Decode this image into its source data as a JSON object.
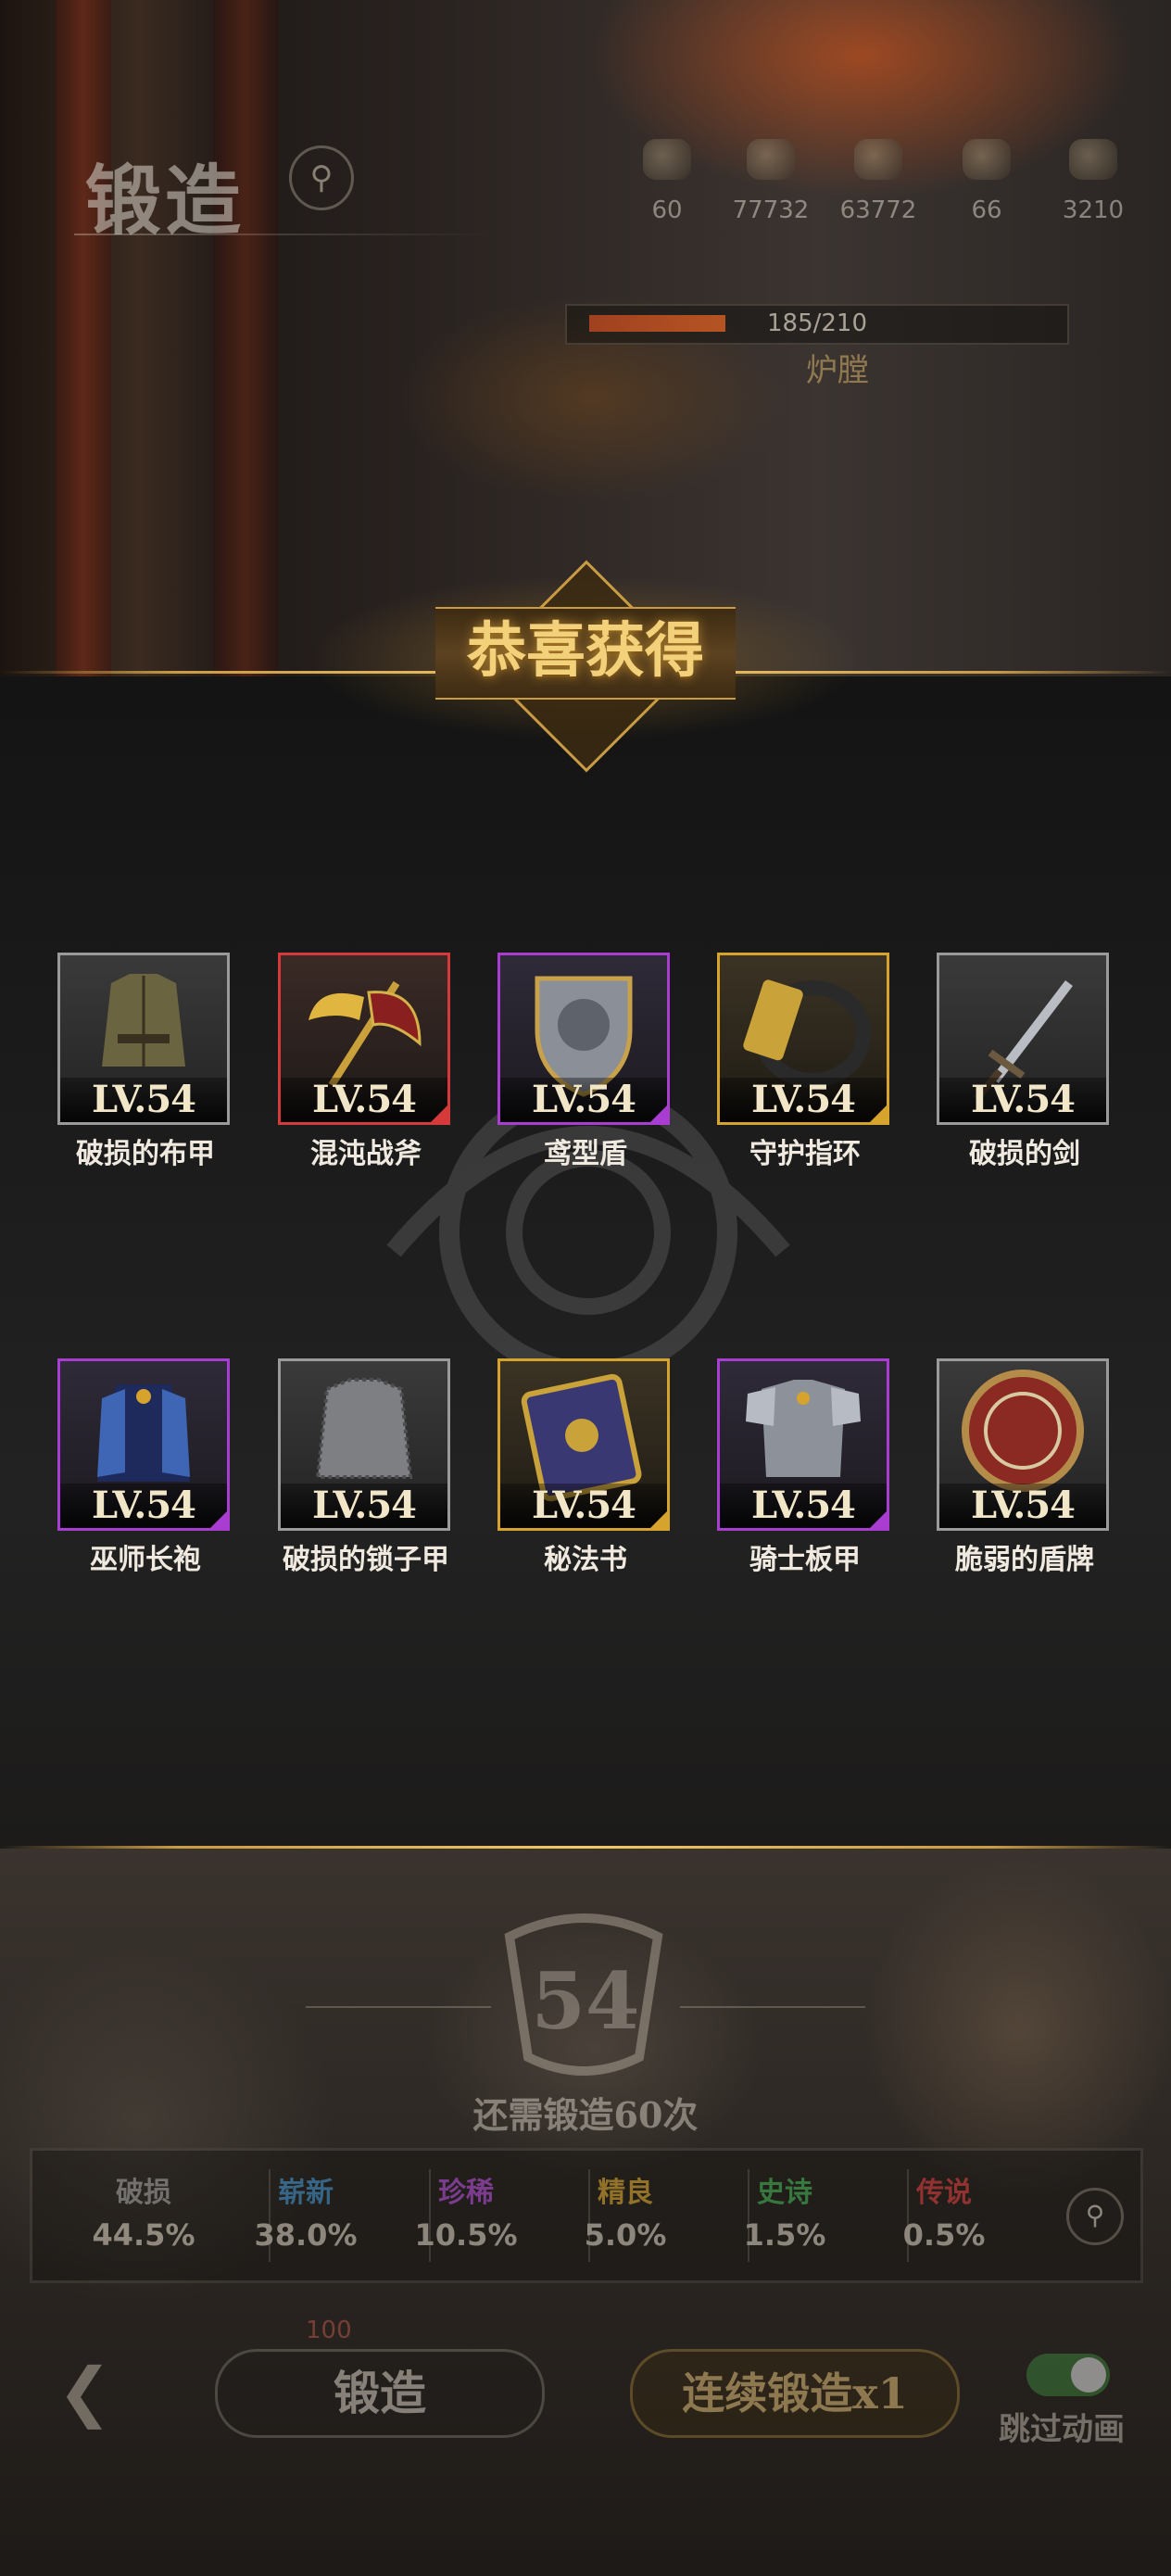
{
  "hud": {
    "title": "锻造",
    "resources": [
      {
        "icon": "ingot-icon",
        "value": "60"
      },
      {
        "icon": "leather-icon",
        "value": "77732"
      },
      {
        "icon": "iron-ore-icon",
        "value": "63772"
      },
      {
        "icon": "crystal-icon",
        "value": "66"
      },
      {
        "icon": "coin-bag-icon",
        "value": "3210"
      }
    ],
    "furnace": {
      "progress_text": "185/210",
      "fill_fraction": 0.3,
      "label": "炉膛"
    }
  },
  "modal": {
    "title": "恭喜获得",
    "items": [
      {
        "name": "破损的布甲",
        "level": "LV.54",
        "rarity": "gray",
        "icon": "cloth-armor-icon"
      },
      {
        "name": "混沌战斧",
        "level": "LV.54",
        "rarity": "red",
        "icon": "battle-axe-icon"
      },
      {
        "name": "鸢型盾",
        "level": "LV.54",
        "rarity": "purple",
        "icon": "lion-shield-icon"
      },
      {
        "name": "守护指环",
        "level": "LV.54",
        "rarity": "gold",
        "icon": "ring-icon"
      },
      {
        "name": "破损的剑",
        "level": "LV.54",
        "rarity": "gray",
        "icon": "sword-icon"
      },
      {
        "name": "巫师长袍",
        "level": "LV.54",
        "rarity": "purple",
        "icon": "wizard-robe-icon"
      },
      {
        "name": "破损的锁子甲",
        "level": "LV.54",
        "rarity": "gray",
        "icon": "chainmail-icon"
      },
      {
        "name": "秘法书",
        "level": "LV.54",
        "rarity": "gold",
        "icon": "spellbook-icon"
      },
      {
        "name": "骑士板甲",
        "level": "LV.54",
        "rarity": "purple",
        "icon": "plate-armor-icon"
      },
      {
        "name": "脆弱的盾牌",
        "level": "LV.54",
        "rarity": "gray",
        "icon": "round-shield-icon"
      }
    ]
  },
  "bottom": {
    "forge_level": "54",
    "auto_forge_text": "还需锻造60次",
    "rates": [
      {
        "name": "破损",
        "value": "44.5%",
        "color": "#9a9a9a"
      },
      {
        "name": "崭新",
        "value": "38.0%",
        "color": "#3d8fc9"
      },
      {
        "name": "珍稀",
        "value": "10.5%",
        "color": "#b04bd6"
      },
      {
        "name": "精良",
        "value": "5.0%",
        "color": "#d6a32d"
      },
      {
        "name": "史诗",
        "value": "1.5%",
        "color": "#3fae52"
      },
      {
        "name": "传说",
        "value": "0.5%",
        "color": "#d43a3a"
      }
    ],
    "forge_button": "锻造",
    "forge_cost": "100",
    "multi_button": "连续锻造x1",
    "multi_cost": "",
    "toggle_label": "跳过动画"
  }
}
